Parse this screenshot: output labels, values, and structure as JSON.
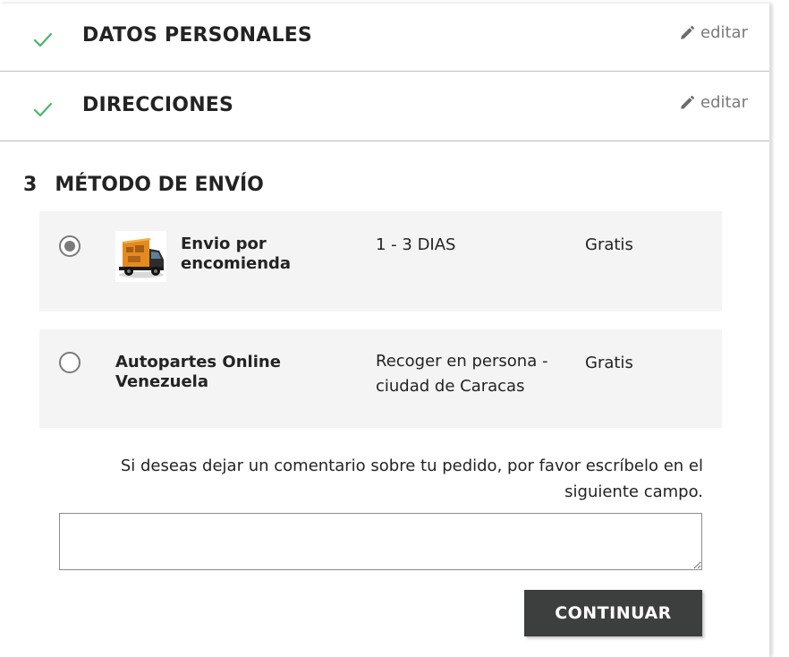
{
  "steps": {
    "personal": {
      "title": "DATOS PERSONALES",
      "edit_label": "editar"
    },
    "addresses": {
      "title": "DIRECCIONES",
      "edit_label": "editar"
    },
    "shipping": {
      "number": "3",
      "title": "MÉTODO DE ENVÍO"
    }
  },
  "shipping_options": [
    {
      "selected": true,
      "carrier_name": "Envio por encomienda",
      "delay": "1 - 3 DIAS",
      "price": "Gratis",
      "logo_icon": "delivery-truck-icon"
    },
    {
      "selected": false,
      "carrier_name": "Autopartes Online Venezuela",
      "delay": "Recoger en persona - ciudad de Caracas",
      "price": "Gratis"
    }
  ],
  "comment": {
    "label": "Si deseas dejar un comentario sobre tu pedido, por favor escríbelo en el siguiente campo.",
    "value": ""
  },
  "continue_label": "CONTINUAR",
  "colors": {
    "check": "#4cb56a",
    "button_bg": "#3d3f3f",
    "option_bg": "#f4f4f4"
  }
}
